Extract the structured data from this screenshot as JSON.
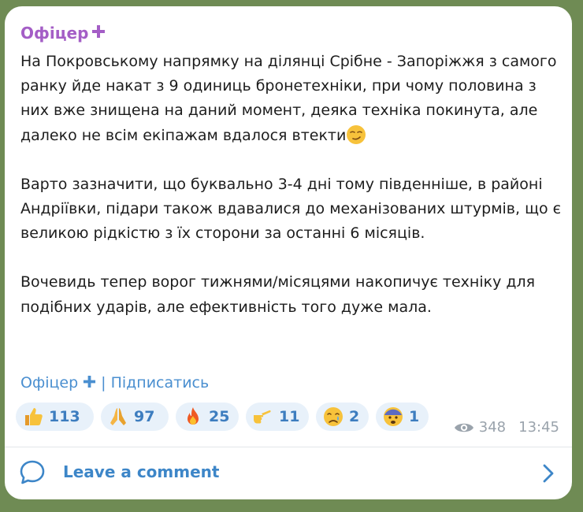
{
  "post": {
    "author": "Офіцер",
    "paragraph1": "На Покровському напрямку на ділянці Срібне - Запоріжжя з самого ранку йде накат з 9 одиниць бронетехніки, при чому половина з них вже знищена на даний момент, деяка техніка покинута, але далеко не всім екіпажам вдалося втекти",
    "paragraph2": "Варто зазначити, що буквально 3-4 дні тому південніше, в районі Андріївки, підари також вдавалися до механізованих штурмів, що є великою рідкістю з їх сторони за останні 6 місяців.",
    "paragraph3": "Вочевидь тепер ворог тижнями/місяцями накопичує техніку для подібних ударів, але ефективність того дуже мала.",
    "signature_name": "Офіцер",
    "signature_separator": "|",
    "signature_link": "Підписатись"
  },
  "reactions": [
    {
      "icon": "thumbs-up-icon",
      "count": "113"
    },
    {
      "icon": "praying-hands-icon",
      "count": "97"
    },
    {
      "icon": "fire-icon",
      "count": "25"
    },
    {
      "icon": "pointing-hand-icon",
      "count": "11"
    },
    {
      "icon": "crying-face-icon",
      "count": "2"
    },
    {
      "icon": "anxious-face-icon",
      "count": "1"
    }
  ],
  "meta": {
    "views": "348",
    "time": "13:45"
  },
  "comments": {
    "label": "Leave a comment"
  },
  "colors": {
    "author": "#a45ec6",
    "link": "#4a8fd0",
    "reaction_bg": "#e8f1fa",
    "reaction_text": "#3d7dbf",
    "meta": "#9aa3ac",
    "background": "#6f8b54"
  }
}
